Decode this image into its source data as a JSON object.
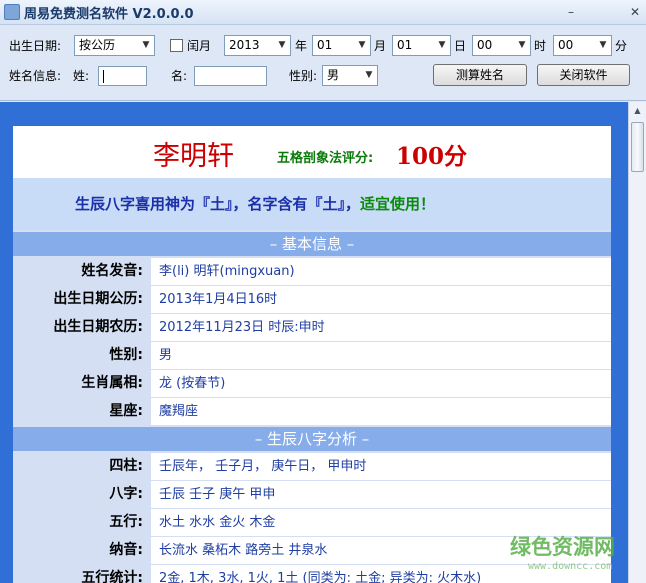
{
  "window": {
    "title": "周易免费测名软件 V2.0.0.0",
    "minimize": "–",
    "close": "✕"
  },
  "toolbar": {
    "birth_label": "出生日期:",
    "calendar_select": "按公历",
    "leap_month_label": "闰月",
    "year_value": "2013",
    "year_unit": "年",
    "month_value": "01",
    "month_unit": "月",
    "day_value": "01",
    "day_unit": "日",
    "hour_value": "00",
    "hour_unit": "时",
    "minute_value": "00",
    "minute_unit": "分",
    "name_info_label": "姓名信息:",
    "surname_label": "姓:",
    "surname_value": "",
    "given_label": "名:",
    "given_value": "",
    "gender_label": "性别:",
    "gender_value": "男",
    "calc_button": "测算姓名",
    "close_button": "关闭软件"
  },
  "report": {
    "name": "李明轩",
    "score_label": "五格剖象法评分:",
    "score_value": "100分",
    "summary_main": "生辰八字喜用神为『土』，名字含有『土』，",
    "summary_ok": "适宜使用！",
    "section_basic": "– 基本信息 –",
    "basic_rows": [
      {
        "key": "姓名发音:",
        "value": "李(li) 明轩(mingxuan)"
      },
      {
        "key": "出生日期公历:",
        "value": "2013年1月4日16时"
      },
      {
        "key": "出生日期农历:",
        "value": "2012年11月23日 时辰:申时"
      },
      {
        "key": "性别:",
        "value": "男"
      },
      {
        "key": "生肖属相:",
        "value": "龙 (按春节)"
      },
      {
        "key": "星座:",
        "value": "魔羯座"
      }
    ],
    "section_bazi": "– 生辰八字分析 –",
    "bazi_rows": [
      {
        "key": "四柱:",
        "value": "壬辰年， 壬子月， 庚午日， 甲申时"
      },
      {
        "key": "八字:",
        "value": "壬辰 壬子 庚午 甲申"
      },
      {
        "key": "五行:",
        "value": "水土 水水 金火 木金"
      },
      {
        "key": "纳音:",
        "value": "长流水 桑柘木 路旁土 井泉水"
      },
      {
        "key": "五行统计:",
        "value": "2金, 1木, 3水, 1火, 1土 (同类为: 土金; 异类为: 火木水)"
      }
    ]
  },
  "watermark": {
    "main": "绿色资源网",
    "sub": "www.downcc.com"
  }
}
